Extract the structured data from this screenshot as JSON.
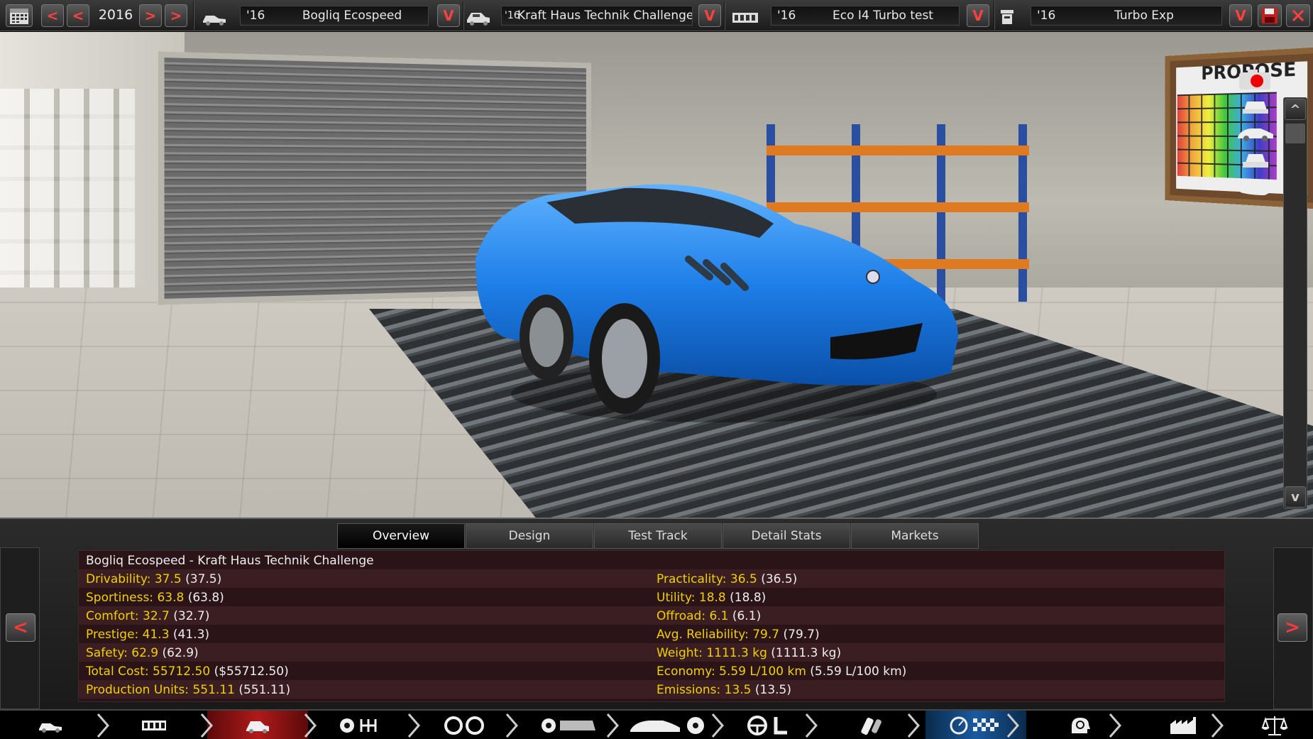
{
  "topbar": {
    "year": "2016",
    "model": {
      "year": "'16",
      "name": "Bogliq Ecospeed"
    },
    "trim": {
      "year": "'16",
      "name": "Kraft Haus Technik Challenge"
    },
    "engine": {
      "year": "'16",
      "name": "Eco I4 Turbo test"
    },
    "engine_variant": {
      "year": "'16",
      "name": "Turbo Exp"
    },
    "dropdown_glyph": "V",
    "prev_glyph": "<",
    "next_glyph": ">"
  },
  "viewport": {
    "board_text": "PROPOSE",
    "scroll_up": "^",
    "scroll_down": "v"
  },
  "tabs": [
    {
      "label": "Overview",
      "active": true
    },
    {
      "label": "Design",
      "active": false
    },
    {
      "label": "Test Track",
      "active": false
    },
    {
      "label": "Detail Stats",
      "active": false
    },
    {
      "label": "Markets",
      "active": false
    }
  ],
  "panel": {
    "prev_glyph": "<",
    "next_glyph": ">",
    "title": "Bogliq Ecospeed - Kraft Haus Technik Challenge",
    "left_stats": [
      {
        "label": "Drivability: 37.5",
        "paren": "(37.5)"
      },
      {
        "label": "Sportiness: 63.8",
        "paren": "(63.8)"
      },
      {
        "label": "Comfort: 32.7",
        "paren": "(32.7)"
      },
      {
        "label": "Prestige: 41.3",
        "paren": "(41.3)"
      },
      {
        "label": "Safety: 62.9",
        "paren": "(62.9)"
      },
      {
        "label": "Total Cost: 55712.50",
        "paren": "($55712.50)"
      },
      {
        "label": "Production Units: 551.11",
        "paren": "(551.11)"
      }
    ],
    "right_stats": [
      {
        "label": "Practicality: 36.5",
        "paren": "(36.5)"
      },
      {
        "label": "Utility: 18.8",
        "paren": "(18.8)"
      },
      {
        "label": "Offroad: 6.1",
        "paren": "(6.1)"
      },
      {
        "label": "Avg. Reliability: 79.7",
        "paren": "(79.7)"
      },
      {
        "label": "Weight: 1111.3 kg",
        "paren": "(1111.3 kg)"
      },
      {
        "label": "Economy: 5.59 L/100 km",
        "paren": "(5.59 L/100 km)"
      },
      {
        "label": "Emissions: 13.5",
        "paren": "(13.5)"
      }
    ]
  },
  "colors": {
    "stat_label": "#f0d000",
    "accent_red": "#ff3838",
    "car_blue": "#1e7fe8",
    "nav_active": "#b01a1a",
    "nav_blue": "#1a5aa0"
  },
  "navbar": [
    {
      "icon": "car-model-icon",
      "state": "normal"
    },
    {
      "icon": "chassis-icon",
      "state": "normal"
    },
    {
      "icon": "trim-icon",
      "state": "active"
    },
    {
      "icon": "drivetrain-icon",
      "state": "normal"
    },
    {
      "icon": "suspension-icon",
      "state": "normal"
    },
    {
      "icon": "body-icon",
      "state": "normal"
    },
    {
      "icon": "engine-cooling-icon",
      "state": "normal"
    },
    {
      "icon": "interior-icon",
      "state": "normal"
    },
    {
      "icon": "fuel-system-icon",
      "state": "normal"
    },
    {
      "icon": "testing-icon",
      "state": "blue"
    },
    {
      "icon": "engineering-icon",
      "state": "normal"
    },
    {
      "icon": "factory-icon",
      "state": "normal"
    },
    {
      "icon": "balance-icon",
      "state": "normal"
    }
  ]
}
